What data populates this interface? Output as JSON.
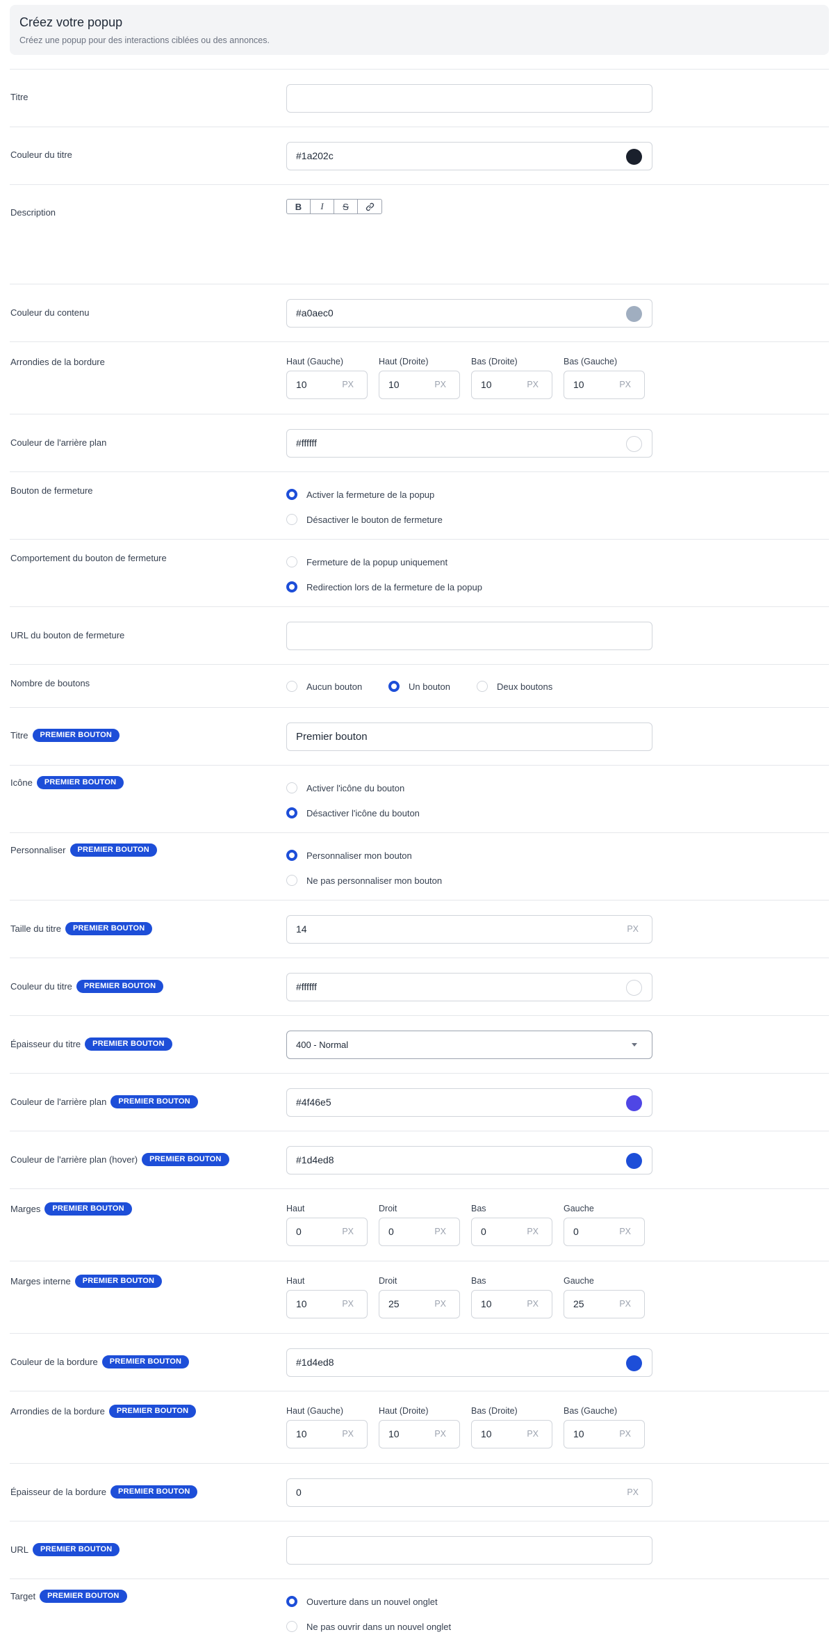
{
  "header": {
    "title": "Créez votre popup",
    "subtitle": "Créez une popup pour des interactions ciblées ou des annonces."
  },
  "badge": "PREMIER BOUTON",
  "unit": "PX",
  "colors": {
    "accent": "#1d4ed8"
  },
  "fields": {
    "titre": {
      "label": "Titre",
      "value": ""
    },
    "couleur_titre": {
      "label": "Couleur du titre",
      "value": "#1a202c",
      "color": "#1a202c"
    },
    "description": {
      "label": "Description",
      "toolbar": [
        "B",
        "I",
        "S",
        "link-icon"
      ]
    },
    "couleur_contenu": {
      "label": "Couleur du contenu",
      "value": "#a0aec0",
      "color": "#a0aec0"
    },
    "arrondies": {
      "label": "Arrondies de la bordure",
      "cells": [
        {
          "label": "Haut (Gauche)",
          "value": "10"
        },
        {
          "label": "Haut (Droite)",
          "value": "10"
        },
        {
          "label": "Bas (Droite)",
          "value": "10"
        },
        {
          "label": "Bas (Gauche)",
          "value": "10"
        }
      ]
    },
    "couleur_arriere": {
      "label": "Couleur de l'arrière plan",
      "value": "#ffffff",
      "color": "#ffffff"
    },
    "bouton_fermeture": {
      "label": "Bouton de fermeture",
      "options": [
        {
          "label": "Activer la fermeture de la popup",
          "checked": true
        },
        {
          "label": "Désactiver le bouton de fermeture",
          "checked": false
        }
      ]
    },
    "comportement_fermeture": {
      "label": "Comportement du bouton de fermeture",
      "options": [
        {
          "label": "Fermeture de la popup uniquement",
          "checked": false
        },
        {
          "label": "Redirection lors de la fermeture de la popup",
          "checked": true
        }
      ]
    },
    "url_fermeture": {
      "label": "URL du bouton de fermeture",
      "value": ""
    },
    "nombre_boutons": {
      "label": "Nombre de boutons",
      "options": [
        {
          "label": "Aucun bouton",
          "checked": false
        },
        {
          "label": "Un bouton",
          "checked": true
        },
        {
          "label": "Deux boutons",
          "checked": false
        }
      ]
    },
    "b_titre": {
      "label": "Titre",
      "value": "Premier bouton"
    },
    "b_icone": {
      "label": "Icône",
      "options": [
        {
          "label": "Activer l'icône du bouton",
          "checked": false
        },
        {
          "label": "Désactiver l'icône du bouton",
          "checked": true
        }
      ]
    },
    "b_personnaliser": {
      "label": "Personnaliser",
      "options": [
        {
          "label": "Personnaliser mon bouton",
          "checked": true
        },
        {
          "label": "Ne pas personnaliser mon bouton",
          "checked": false
        }
      ]
    },
    "b_taille_titre": {
      "label": "Taille du titre",
      "value": "14"
    },
    "b_couleur_titre": {
      "label": "Couleur du titre",
      "value": "#ffffff",
      "color": "#ffffff"
    },
    "b_epaisseur_titre": {
      "label": "Épaisseur du titre",
      "value": "400 - Normal"
    },
    "b_couleur_arriere": {
      "label": "Couleur de l'arrière plan",
      "value": "#4f46e5",
      "color": "#4f46e5"
    },
    "b_couleur_arriere_hover": {
      "label": "Couleur de l'arrière plan (hover)",
      "value": "#1d4ed8",
      "color": "#1d4ed8"
    },
    "b_marges": {
      "label": "Marges",
      "cells": [
        {
          "label": "Haut",
          "value": "0"
        },
        {
          "label": "Droit",
          "value": "0"
        },
        {
          "label": "Bas",
          "value": "0"
        },
        {
          "label": "Gauche",
          "value": "0"
        }
      ]
    },
    "b_marges_interne": {
      "label": "Marges interne",
      "cells": [
        {
          "label": "Haut",
          "value": "10"
        },
        {
          "label": "Droit",
          "value": "25"
        },
        {
          "label": "Bas",
          "value": "10"
        },
        {
          "label": "Gauche",
          "value": "25"
        }
      ]
    },
    "b_couleur_bordure": {
      "label": "Couleur de la bordure",
      "value": "#1d4ed8",
      "color": "#1d4ed8"
    },
    "b_arrondies": {
      "label": "Arrondies de la bordure",
      "cells": [
        {
          "label": "Haut (Gauche)",
          "value": "10"
        },
        {
          "label": "Haut (Droite)",
          "value": "10"
        },
        {
          "label": "Bas (Droite)",
          "value": "10"
        },
        {
          "label": "Bas (Gauche)",
          "value": "10"
        }
      ]
    },
    "b_epaisseur_bordure": {
      "label": "Épaisseur de la bordure",
      "value": "0"
    },
    "b_url": {
      "label": "URL",
      "value": ""
    },
    "b_target": {
      "label": "Target",
      "options": [
        {
          "label": "Ouverture dans un nouvel onglet",
          "checked": true
        },
        {
          "label": "Ne pas ouvrir dans un nouvel onglet",
          "checked": false
        }
      ]
    }
  }
}
